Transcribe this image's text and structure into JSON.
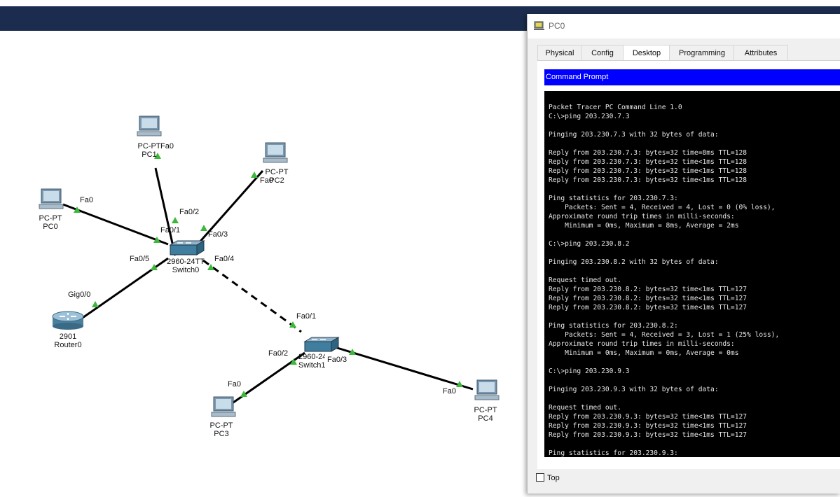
{
  "pc_window": {
    "title": "PC0",
    "tabs": [
      "Physical",
      "Config",
      "Desktop",
      "Programming",
      "Attributes"
    ],
    "active_tab": "Desktop",
    "command_prompt_title": "Command Prompt",
    "console_text": "Packet Tracer PC Command Line 1.0\nC:\\>ping 203.230.7.3\n\nPinging 203.230.7.3 with 32 bytes of data:\n\nReply from 203.230.7.3: bytes=32 time=8ms TTL=128\nReply from 203.230.7.3: bytes=32 time<1ms TTL=128\nReply from 203.230.7.3: bytes=32 time<1ms TTL=128\nReply from 203.230.7.3: bytes=32 time<1ms TTL=128\n\nPing statistics for 203.230.7.3:\n    Packets: Sent = 4, Received = 4, Lost = 0 (0% loss),\nApproximate round trip times in milli-seconds:\n    Minimum = 0ms, Maximum = 8ms, Average = 2ms\n\nC:\\>ping 203.230.8.2\n\nPinging 203.230.8.2 with 32 bytes of data:\n\nRequest timed out.\nReply from 203.230.8.2: bytes=32 time<1ms TTL=127\nReply from 203.230.8.2: bytes=32 time<1ms TTL=127\nReply from 203.230.8.2: bytes=32 time<1ms TTL=127\n\nPing statistics for 203.230.8.2:\n    Packets: Sent = 4, Received = 3, Lost = 1 (25% loss),\nApproximate round trip times in milli-seconds:\n    Minimum = 0ms, Maximum = 0ms, Average = 0ms\n\nC:\\>ping 203.230.9.3\n\nPinging 203.230.9.3 with 32 bytes of data:\n\nRequest timed out.\nReply from 203.230.9.3: bytes=32 time<1ms TTL=127\nReply from 203.230.9.3: bytes=32 time<1ms TTL=127\nReply from 203.230.9.3: bytes=32 time<1ms TTL=127\n\nPing statistics for 203.230.9.3:",
    "top_checkbox_label": "Top"
  },
  "topology": {
    "devices": {
      "pc0": {
        "model": "PC-PT",
        "name": "PC0"
      },
      "pc1": {
        "model": "PC-PT",
        "name": "PC1"
      },
      "pc2": {
        "model": "PC-PT",
        "name": "PC2"
      },
      "pc3": {
        "model": "PC-PT",
        "name": "PC3"
      },
      "pc4": {
        "model": "PC-PT",
        "name": "PC4"
      },
      "switch0": {
        "model": "2960-24TT",
        "name": "Switch0"
      },
      "switch1": {
        "model": "2960-24TT",
        "name": "Switch1"
      },
      "router0": {
        "model": "2901",
        "name": "Router0"
      }
    },
    "ports": {
      "pc0_fa0": "Fa0",
      "pc1_fa0": "Fa0",
      "pc2_fa0": "Fa0",
      "pc3_fa0": "Fa0",
      "pc4_fa0": "Fa0",
      "sw0_fa01": "Fa0/1",
      "sw0_fa02": "Fa0/2",
      "sw0_fa03": "Fa0/3",
      "sw0_fa04": "Fa0/4",
      "sw0_fa05": "Fa0/5",
      "r0_gig00": "Gig0/0",
      "sw1_fa01": "Fa0/1",
      "sw1_fa02": "Fa0/2",
      "sw1_fa03": "Fa0/3"
    }
  },
  "colors": {
    "titlebar": "#1b2c4e",
    "link_up": "#3db83d",
    "cmd_header": "#0000ff",
    "console_bg": "#000000"
  }
}
